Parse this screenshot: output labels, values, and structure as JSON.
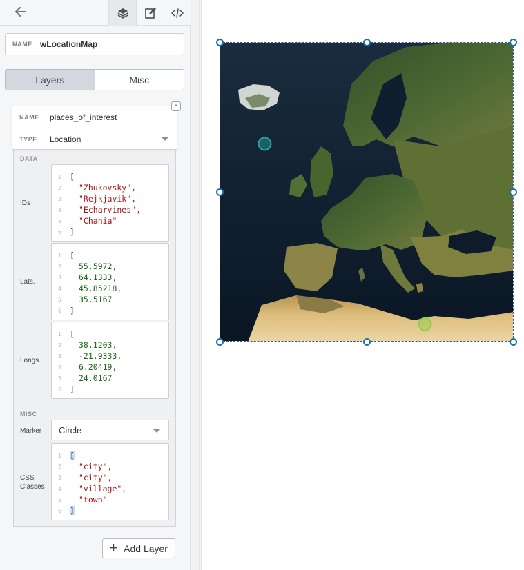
{
  "widget": {
    "name_label": "NAME",
    "name_value": "wLocationMap"
  },
  "tabs": [
    {
      "label": "Layers",
      "active": true
    },
    {
      "label": "Misc",
      "active": false
    }
  ],
  "layer": {
    "remove_symbol": "×",
    "name_label": "NAME",
    "name_value": "places_of_interest",
    "type_label": "TYPE",
    "type_value": "Location",
    "data_section": "DATA",
    "ids_label": "IDs",
    "ids": [
      "\"Zhukovsky\",",
      "\"Rejkjavik\",",
      "\"Echarvines\",",
      "\"Chania\""
    ],
    "lats_label": "Lats.",
    "lats": [
      "55.5972,",
      "64.1333,",
      "45.85218,",
      "35.5167"
    ],
    "longs_label": "Longs.",
    "longs": [
      "38.1203,",
      "-21.9333,",
      "6.20419,",
      "24.0167"
    ],
    "misc_section": "MISC",
    "marker_label": "Marker",
    "marker_value": "Circle",
    "css_label_line1": "CSS",
    "css_label_line2": "Classes",
    "css_classes": [
      "\"city\",",
      "\"city\",",
      "\"village\",",
      "\"town\""
    ]
  },
  "code": {
    "open": "[",
    "close": "]",
    "line_numbers": [
      "1",
      "2",
      "3",
      "4",
      "5",
      "6"
    ]
  },
  "add_layer": {
    "icon": "+",
    "label": "Add Layer"
  },
  "markers": [
    {
      "id": "Zhukovsky",
      "css_class": "city",
      "color": "#2aa7a1"
    },
    {
      "id": "Rejkjavik",
      "css_class": "city",
      "color": "#2aa7a1"
    },
    {
      "id": "Echarvines",
      "css_class": "village",
      "color": "#8fcf4a"
    },
    {
      "id": "Chania",
      "css_class": "town",
      "color": "#e0336b"
    }
  ],
  "colors": {
    "selection": "#1d6fb0",
    "sea": "#0c1a2a",
    "land": "#3c5a2a",
    "desert": "#d9b774"
  }
}
